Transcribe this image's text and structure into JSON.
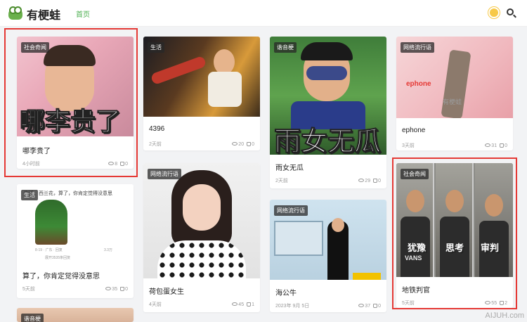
{
  "header": {
    "logo_text": "有梗蛙",
    "nav_home": "首页"
  },
  "cards": {
    "c1": {
      "tag": "社会奇闻",
      "overlay": "哪李贵了",
      "title": "哪李贵了",
      "time": "4小时前",
      "views": "8",
      "likes": "0"
    },
    "c2": {
      "tag": "生活",
      "title": "4396",
      "time": "2天前",
      "views": "20",
      "likes": "0"
    },
    "c3": {
      "tag": "谐音梗",
      "overlay": "雨女无瓜",
      "title": "雨女无瓜",
      "time": "2天前",
      "views": "29",
      "likes": "0"
    },
    "c4": {
      "tag": "网络流行语",
      "overlay": "ephone",
      "image_watermark": "有梗蛙",
      "title": "ephone",
      "time": "3天前",
      "views": "31",
      "likes": "0"
    },
    "c5": {
      "tag": "生活",
      "post_text": "生活。西兰花，算了，你肯定觉得没意思",
      "post_footer": "8-19 · 广东 · 回复",
      "post_likes": "3.3万",
      "post_more": "展开3535条回复",
      "title": "算了，你肯定觉得没意思",
      "time": "5天前",
      "views": "35",
      "likes": "0"
    },
    "c6": {
      "tag": "网络流行语",
      "title": "荷包蛋女生",
      "time": "4天前",
      "views": "45",
      "likes": "1"
    },
    "c7": {
      "tag": "网络流行语",
      "title": "海公牛",
      "time": "2023年 9月 5日",
      "views": "37",
      "likes": "0"
    },
    "c8": {
      "tag": "社会奇闻",
      "overlay1": "犹豫",
      "overlay2": "思考",
      "overlay3": "审判",
      "shirt": "VANS",
      "title": "地铁判官",
      "time": "5天前",
      "views": "55",
      "likes": "2"
    },
    "c9": {
      "tag": "谐音梗"
    }
  },
  "watermark": "AIJUH.com",
  "colors": {
    "accent": "#4caf50",
    "highlight": "#e53935"
  }
}
